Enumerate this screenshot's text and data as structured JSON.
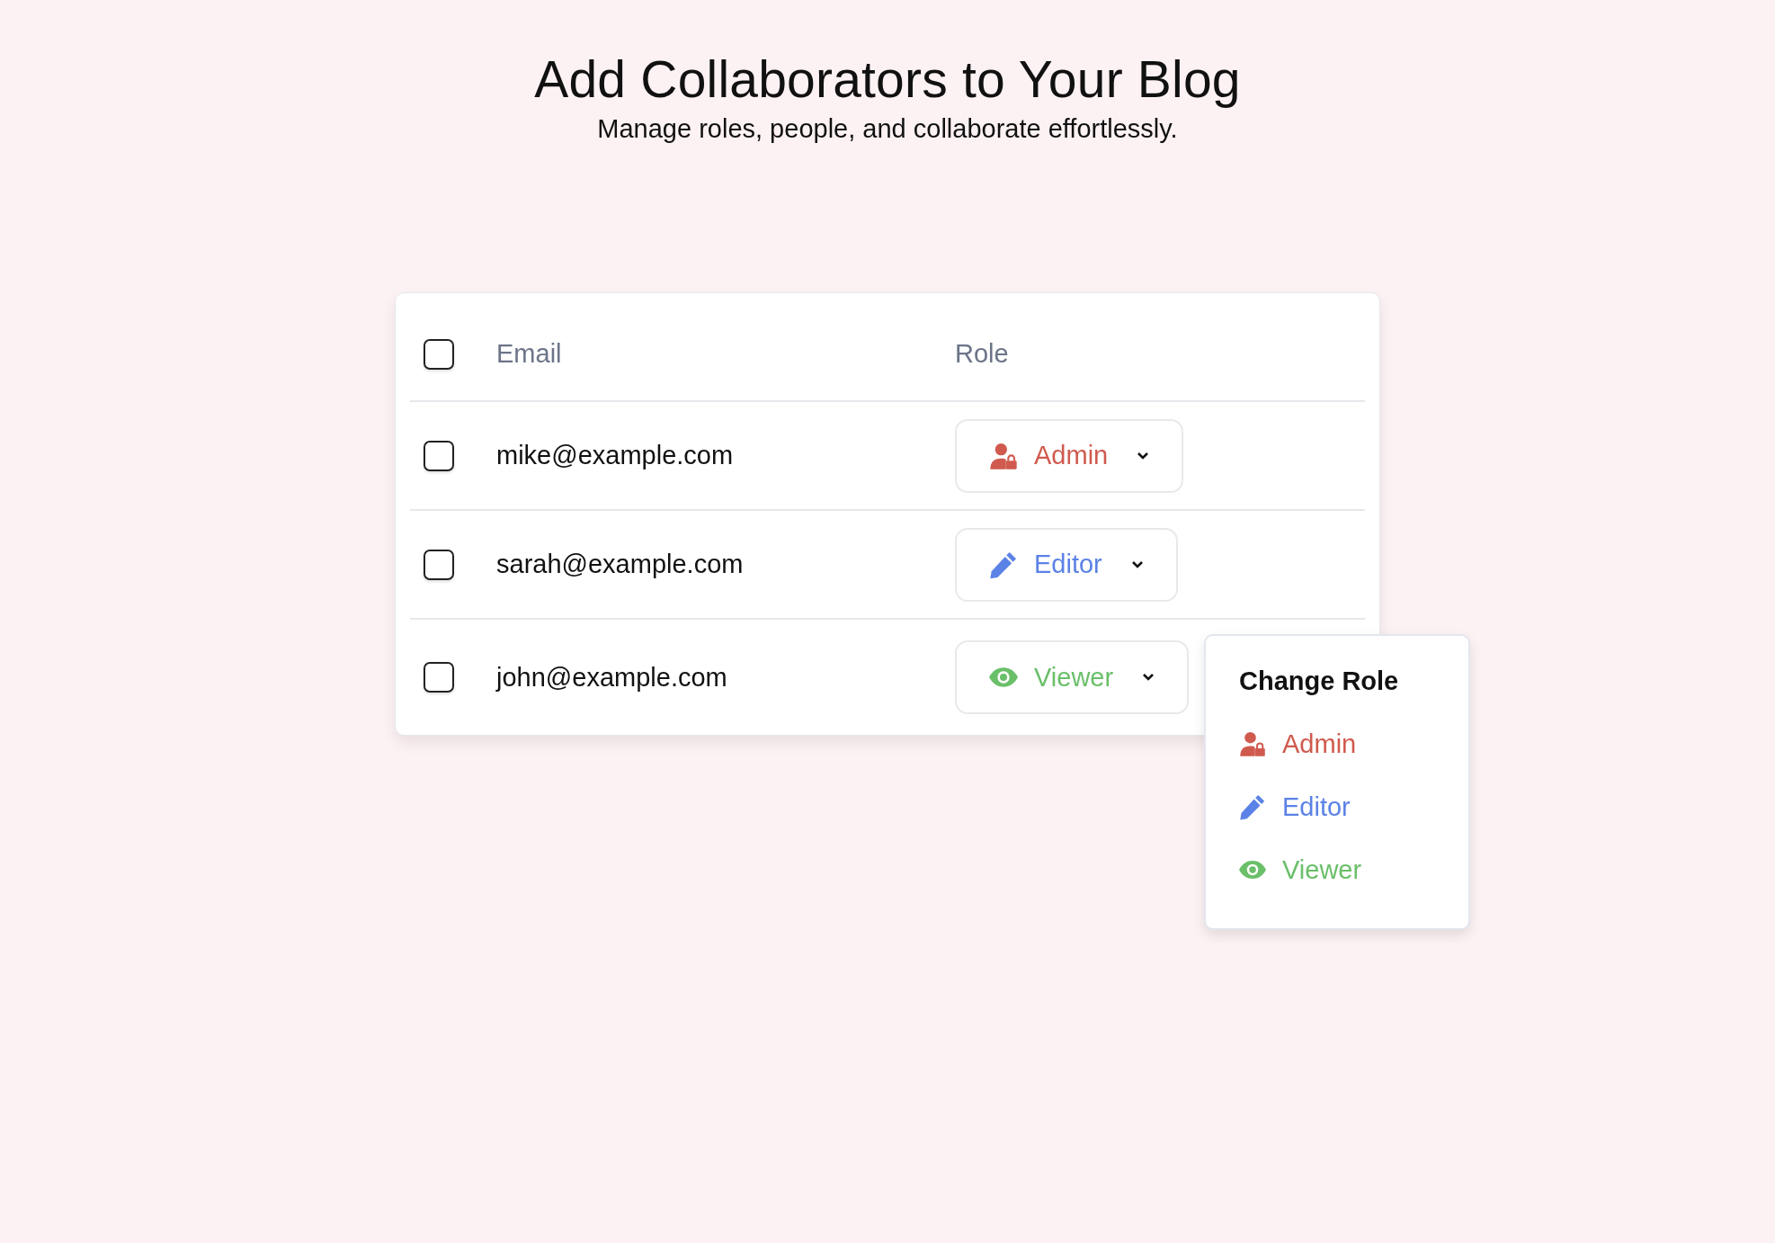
{
  "header": {
    "title": "Add Collaborators to Your Blog",
    "subtitle": "Manage roles, people, and collaborate effortlessly."
  },
  "table": {
    "select_all": {
      "checked": false
    },
    "columns": [
      "Email",
      "Role"
    ],
    "rows": [
      {
        "email": "mike@example.com",
        "checked": false,
        "role": {
          "kind": "admin",
          "label": "Admin"
        }
      },
      {
        "email": "sarah@example.com",
        "checked": false,
        "role": {
          "kind": "editor",
          "label": "Editor"
        }
      },
      {
        "email": "john@example.com",
        "checked": false,
        "role": {
          "kind": "viewer",
          "label": "Viewer"
        }
      }
    ]
  },
  "role_menu": {
    "title": "Change Role",
    "items": [
      {
        "kind": "admin",
        "label": "Admin"
      },
      {
        "kind": "editor",
        "label": "Editor"
      },
      {
        "kind": "viewer",
        "label": "Viewer"
      }
    ]
  }
}
